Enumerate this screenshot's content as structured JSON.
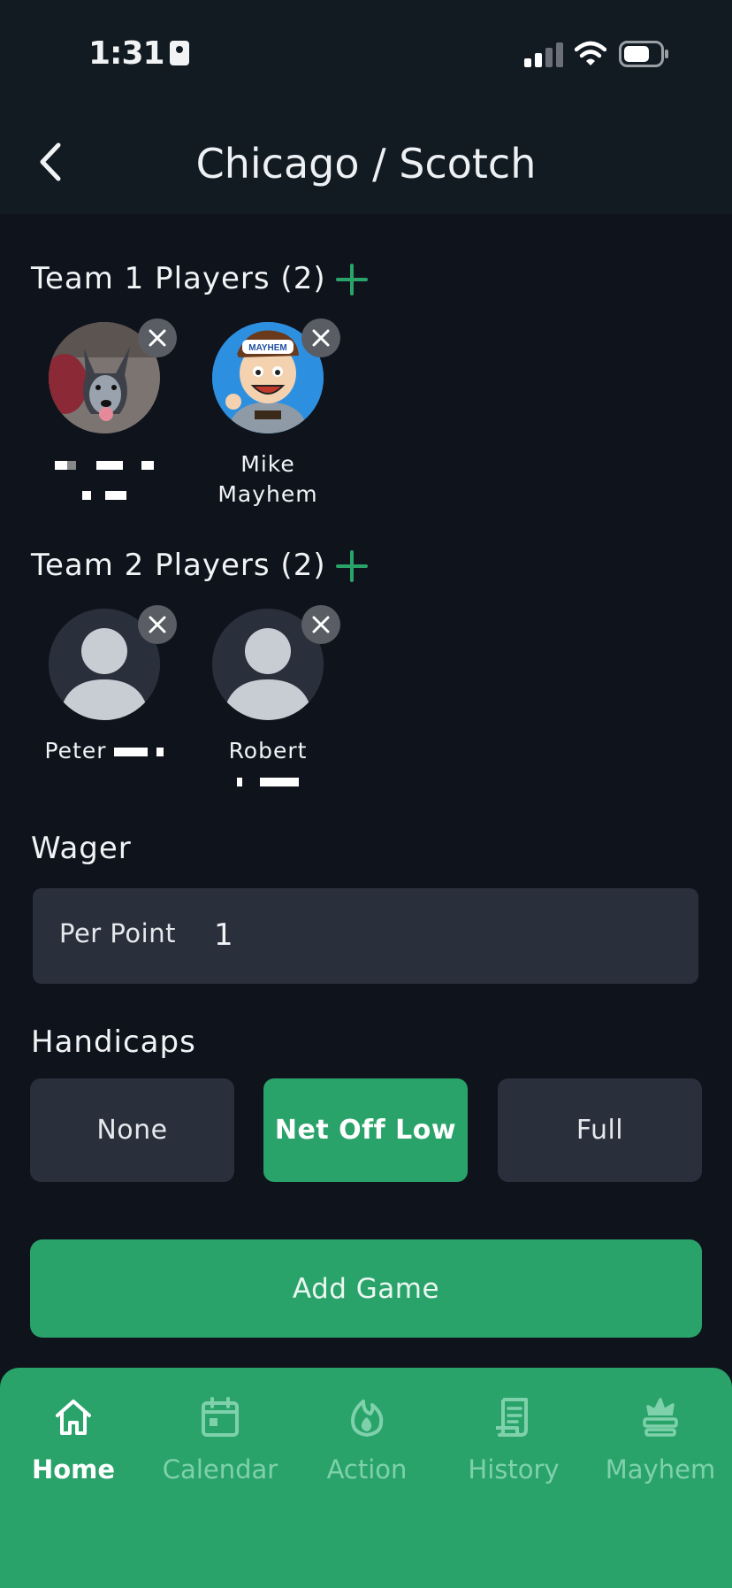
{
  "status": {
    "time": "1:31"
  },
  "header": {
    "title": "Chicago / Scotch"
  },
  "team1": {
    "title": "Team 1 Players (2)",
    "players": [
      {
        "name_line1": "",
        "name_line2": ""
      },
      {
        "name_line1": "Mike",
        "name_line2": "Mayhem"
      }
    ]
  },
  "team2": {
    "title": "Team 2 Players (2)",
    "players": [
      {
        "name_line1": "Peter",
        "name_line2": ""
      },
      {
        "name_line1": "Robert",
        "name_line2": ""
      }
    ]
  },
  "wager": {
    "title": "Wager",
    "label": "Per Point",
    "value": "1"
  },
  "handicaps": {
    "title": "Handicaps",
    "options": [
      "None",
      "Net Off Low",
      "Full"
    ],
    "selected": "Net Off Low"
  },
  "add_game_label": "Add Game",
  "tabs": [
    {
      "label": "Home",
      "icon": "home-icon",
      "active": true
    },
    {
      "label": "Calendar",
      "icon": "calendar-icon",
      "active": false
    },
    {
      "label": "Action",
      "icon": "flame-icon",
      "active": false
    },
    {
      "label": "History",
      "icon": "receipt-icon",
      "active": false
    },
    {
      "label": "Mayhem",
      "icon": "explosion-icon",
      "active": false
    }
  ],
  "colors": {
    "accent": "#2aa36b",
    "background": "#0f131c",
    "surface": "#2a2f3c"
  }
}
